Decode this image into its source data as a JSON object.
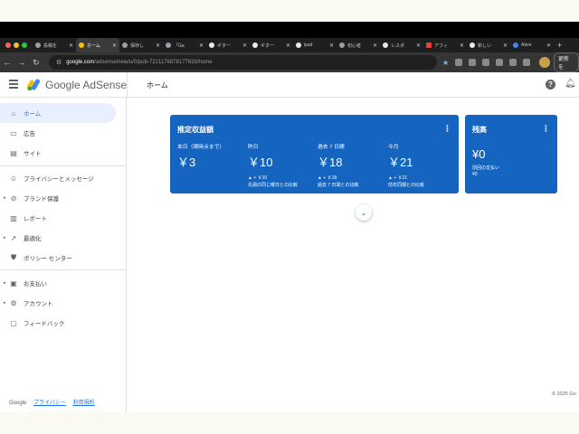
{
  "browser": {
    "tabs": [
      {
        "label": "投稿を"
      },
      {
        "label": "ホーム",
        "active": true
      },
      {
        "label": "保存し"
      },
      {
        "label": "「Ga"
      },
      {
        "label": "ギター"
      },
      {
        "label": "ギター"
      },
      {
        "label": "ipad"
      },
      {
        "label": "初心者"
      },
      {
        "label": "レスポ"
      },
      {
        "label": "アフィ"
      },
      {
        "label": "新しい"
      },
      {
        "label": "Adve"
      }
    ],
    "new_tab": "+",
    "url_host": "google.com",
    "url_path": "/adsense/new/u/0/pub-7221176878177833/home",
    "update_label": "更新を"
  },
  "header": {
    "brand": "Google AdSense",
    "page_title": "ホーム",
    "help_icon": "?"
  },
  "sidebar": {
    "items": [
      {
        "label": "ホーム",
        "icon": "home-icon",
        "glyph": "⌂",
        "active": true
      },
      {
        "label": "広告",
        "icon": "ads-icon",
        "glyph": "▭"
      },
      {
        "label": "サイト",
        "icon": "sites-icon",
        "glyph": "▤"
      },
      {
        "label": "プライバシーとメッセージ",
        "icon": "privacy-icon",
        "glyph": "☺"
      },
      {
        "label": "ブランド保護",
        "icon": "block-icon",
        "glyph": "⊘",
        "caret": true
      },
      {
        "label": "レポート",
        "icon": "report-icon",
        "glyph": "▥"
      },
      {
        "label": "最適化",
        "icon": "trending-icon",
        "glyph": "↗",
        "caret": true
      },
      {
        "label": "ポリシー センター",
        "icon": "policy-icon",
        "glyph": "⛊"
      },
      {
        "label": "お支払い",
        "icon": "payments-icon",
        "glyph": "▣",
        "caret": true
      },
      {
        "label": "アカウント",
        "icon": "account-gear-icon",
        "glyph": "⚙",
        "caret": true
      },
      {
        "label": "フィードバック",
        "icon": "feedback-icon",
        "glyph": "▢"
      }
    ],
    "footer": {
      "google": "Google",
      "privacy": "プライバシー",
      "terms": "利用規約"
    }
  },
  "earnings_card": {
    "title": "推定収益額",
    "metrics": [
      {
        "label": "本日（現時点まで）",
        "value": "￥3",
        "delta": "",
        "compare": ""
      },
      {
        "label": "昨日",
        "value": "￥10",
        "delta": "▲ + ￥10",
        "compare": "先週の同じ曜日との比較"
      },
      {
        "label": "過去 7 日間",
        "value": "￥18",
        "delta": "▲ + ￥18",
        "compare": "過去 7 日間との比較"
      },
      {
        "label": "今月",
        "value": "￥21",
        "delta": "▲ + ￥21",
        "compare": "前年同期との比較"
      }
    ]
  },
  "balance_card": {
    "title": "残高",
    "value": "¥0",
    "sub_label": "前回の支払い",
    "sub_value": "¥0"
  },
  "footer": {
    "copyright": "© 2025 Go"
  },
  "colors": {
    "accent": "#1a73e8",
    "card": "#1565c0",
    "browser_dark": "#1f1f1f"
  }
}
